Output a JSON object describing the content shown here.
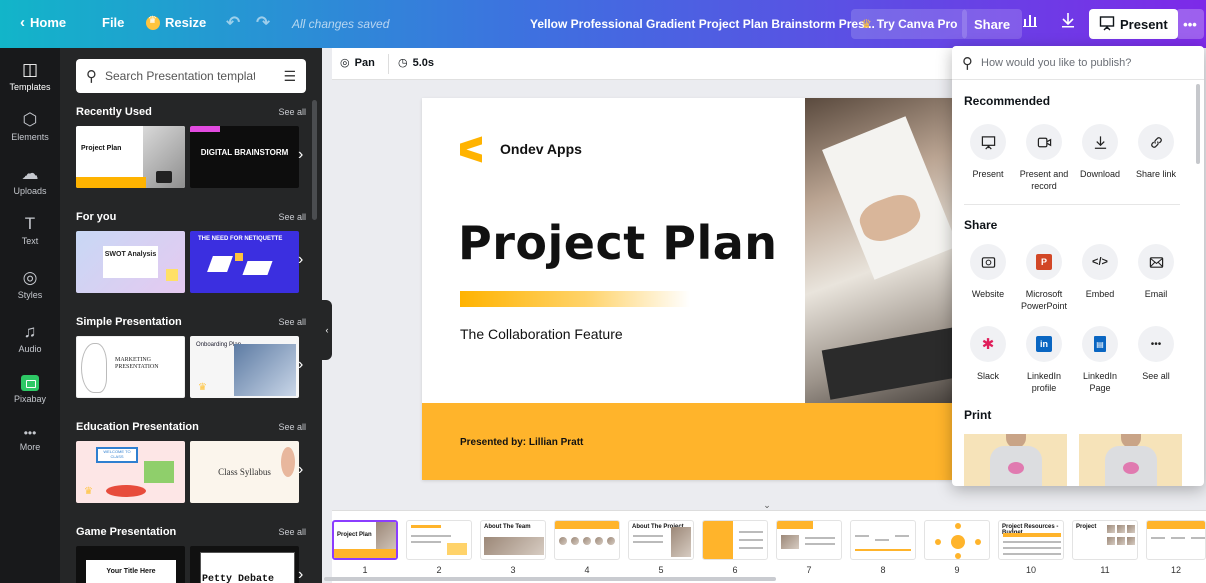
{
  "topbar": {
    "home": "Home",
    "file": "File",
    "resize": "Resize",
    "saved_status": "All changes saved",
    "doc_title": "Yellow Professional Gradient Project Plan Brainstorm Pres...",
    "try_pro": "Try Canva Pro",
    "share": "Share",
    "present": "Present",
    "more": "•••"
  },
  "sidebar": {
    "items": [
      {
        "label": "Templates",
        "icon": "templates-icon"
      },
      {
        "label": "Elements",
        "icon": "elements-icon"
      },
      {
        "label": "Uploads",
        "icon": "uploads-icon"
      },
      {
        "label": "Text",
        "icon": "text-icon"
      },
      {
        "label": "Styles",
        "icon": "styles-icon"
      },
      {
        "label": "Audio",
        "icon": "audio-icon"
      },
      {
        "label": "Pixabay",
        "icon": "pixabay-icon"
      },
      {
        "label": "More",
        "icon": "more-icon"
      }
    ]
  },
  "templates_panel": {
    "search_placeholder": "Search Presentation templates",
    "see_all": "See all",
    "sections": [
      {
        "title": "Recently Used",
        "thumbs": [
          "Project Plan",
          "DIGITAL BRAINSTORM"
        ]
      },
      {
        "title": "For you",
        "thumbs": [
          "SWOT Analysis",
          "THE NEED FOR NETIQUETTE"
        ]
      },
      {
        "title": "Simple Presentation",
        "thumbs": [
          "MARKETING PRESENTATION",
          "Onboarding Plan"
        ]
      },
      {
        "title": "Education Presentation",
        "thumbs": [
          "WELCOME TO CLASS",
          "Class Syllabus"
        ]
      },
      {
        "title": "Game Presentation",
        "thumbs": [
          "Your Title Here",
          "Petty Debate"
        ]
      }
    ]
  },
  "canvas_toolbar": {
    "pan": "Pan",
    "duration": "5.0s"
  },
  "slide": {
    "brand": "Ondev Apps",
    "title": "Project Plan",
    "subtitle": "The Collaboration Feature",
    "presented_by": "Presented by: Lillian Pratt",
    "accent_color": "#ffb42b"
  },
  "publish_menu": {
    "search_placeholder": "How would you like to publish?",
    "recommended_title": "Recommended",
    "recommended": [
      {
        "label": "Present",
        "icon": "present-icon"
      },
      {
        "label": "Present and record",
        "icon": "record-icon"
      },
      {
        "label": "Download",
        "icon": "download-icon"
      },
      {
        "label": "Share link",
        "icon": "link-icon"
      }
    ],
    "share_title": "Share",
    "share": [
      {
        "label": "Website",
        "icon": "website-icon"
      },
      {
        "label": "Microsoft PowerPoint",
        "icon": "powerpoint-icon"
      },
      {
        "label": "Embed",
        "icon": "embed-icon"
      },
      {
        "label": "Email",
        "icon": "email-icon"
      },
      {
        "label": "Slack",
        "icon": "slack-icon"
      },
      {
        "label": "LinkedIn profile",
        "icon": "linkedin-icon"
      },
      {
        "label": "LinkedIn Page",
        "icon": "linkedin-page-icon"
      },
      {
        "label": "See all",
        "icon": "more-icon"
      }
    ],
    "print_title": "Print"
  },
  "pages": {
    "selected": 1,
    "numbers": [
      "1",
      "2",
      "3",
      "4",
      "5",
      "6",
      "7",
      "8",
      "9",
      "10",
      "11",
      "12"
    ]
  }
}
